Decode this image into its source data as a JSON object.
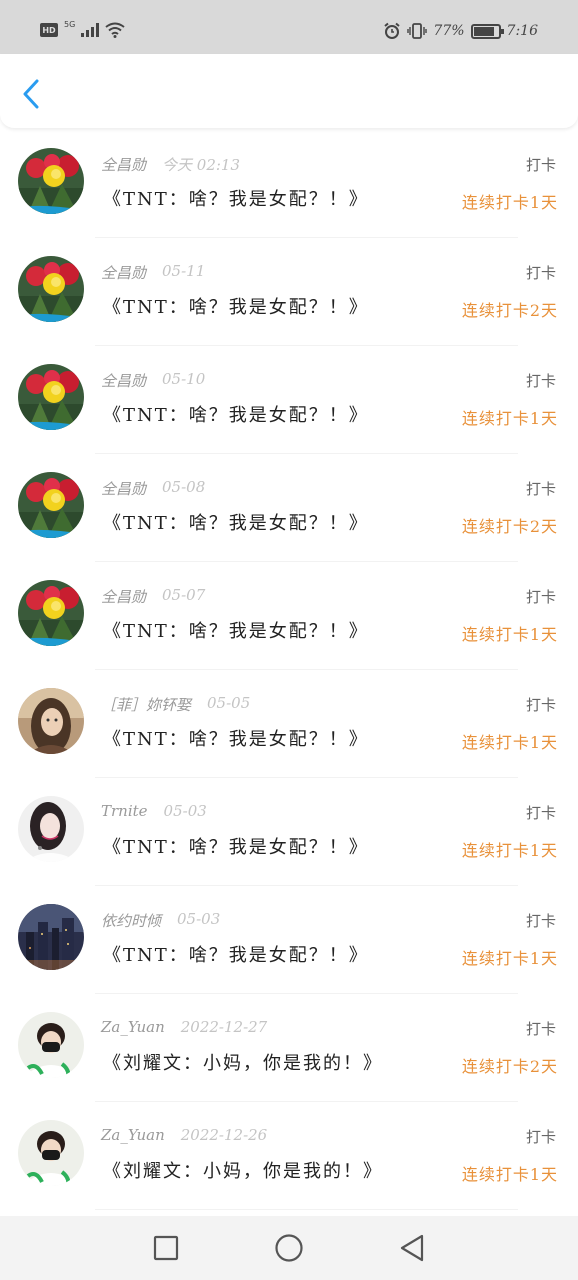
{
  "status_bar": {
    "hd": "HD",
    "network": "5G",
    "battery_text": "77%",
    "battery_level": 0.77,
    "time": "7:16"
  },
  "header": {
    "back_icon": "chevron-left-icon",
    "accent_color": "#2a9cf0"
  },
  "streak_color": "#e8913a",
  "items": [
    {
      "user": "全昌勋",
      "time": "今天 02:13",
      "book": "《TNT：啥？我是女配？！》",
      "label": "打卡",
      "streak": "连续打卡1天",
      "avatar": "cactus"
    },
    {
      "user": "全昌勋",
      "time": "05-11",
      "book": "《TNT：啥？我是女配？！》",
      "label": "打卡",
      "streak": "连续打卡2天",
      "avatar": "cactus"
    },
    {
      "user": "全昌勋",
      "time": "05-10",
      "book": "《TNT：啥？我是女配？！》",
      "label": "打卡",
      "streak": "连续打卡1天",
      "avatar": "cactus"
    },
    {
      "user": "全昌勋",
      "time": "05-08",
      "book": "《TNT：啥？我是女配？！》",
      "label": "打卡",
      "streak": "连续打卡2天",
      "avatar": "cactus"
    },
    {
      "user": "全昌勋",
      "time": "05-07",
      "book": "《TNT：啥？我是女配？！》",
      "label": "打卡",
      "streak": "连续打卡1天",
      "avatar": "cactus"
    },
    {
      "user": "［菲］妳钚娶",
      "time": "05-05",
      "book": "《TNT：啥？我是女配？！》",
      "label": "打卡",
      "streak": "连续打卡1天",
      "avatar": "girl-warm"
    },
    {
      "user": "Trnite",
      "time": "05-03",
      "book": "《TNT：啥？我是女配？！》",
      "label": "打卡",
      "streak": "连续打卡1天",
      "avatar": "girl-white"
    },
    {
      "user": "依约时倾",
      "time": "05-03",
      "book": "《TNT：啥？我是女配？！》",
      "label": "打卡",
      "streak": "连续打卡1天",
      "avatar": "city-night"
    },
    {
      "user": "Za_Yuan",
      "time": "2022-12-27",
      "book": "《刘耀文：小妈，你是我的！》",
      "label": "打卡",
      "streak": "连续打卡2天",
      "avatar": "boy-mask"
    },
    {
      "user": "Za_Yuan",
      "time": "2022-12-26",
      "book": "《刘耀文：小妈，你是我的！》",
      "label": "打卡",
      "streak": "连续打卡1天",
      "avatar": "boy-mask"
    }
  ],
  "nav": {
    "recents_icon": "square-icon",
    "home_icon": "circle-icon",
    "back_icon": "triangle-back-icon"
  }
}
